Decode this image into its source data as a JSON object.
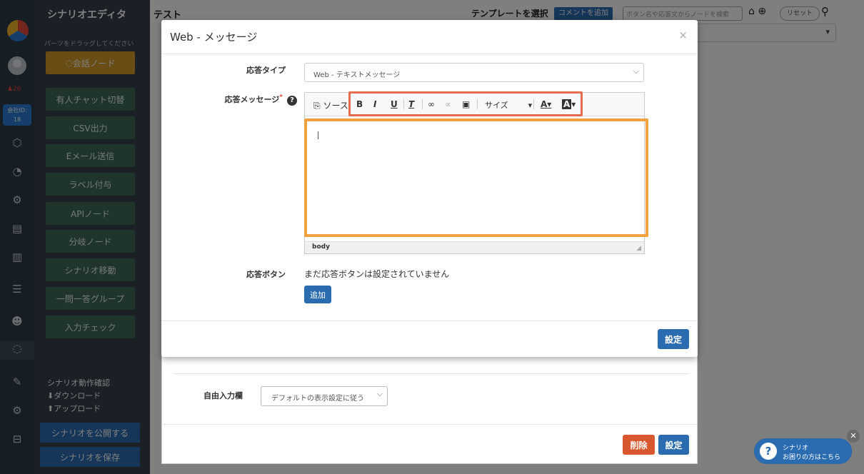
{
  "app": {
    "palette_title": "シナリオエディタ",
    "palette_hint": "パーツをドラッグしてください",
    "notification_count": "26",
    "company_id_label": "会社ID:",
    "company_id": "18",
    "palette_buttons": [
      "会話ノード",
      "有人チャット切替",
      "CSV出力",
      "Eメール送信",
      "ラベル付与",
      "APIノード",
      "分岐ノード",
      "シナリオ移動",
      "一問一答グループ",
      "入力チェック"
    ],
    "links": [
      "シナリオ動作確認",
      "ダウンロード",
      "アップロード"
    ],
    "publish_button": "シナリオを公開する",
    "save_button": "シナリオを保存"
  },
  "topbar": {
    "scenario_name": "テスト",
    "template_label": "テンプレートを選択",
    "comment_button": "コメントを追加",
    "search_placeholder": "ボタン名や応答文からノードを検索",
    "reset_button": "リセット"
  },
  "under_panel": {
    "free_input_label": "自由入力欄",
    "free_input_value": "デフォルトの表示設定に従う",
    "delete_button": "削除",
    "save_button": "設定"
  },
  "modal": {
    "title": "Web - メッセージ",
    "close": "×",
    "response_type_label": "応答タイプ",
    "response_type_value": "Web - テキストメッセージ",
    "response_message_label": "応答メッセージ",
    "required_mark": "*",
    "toolbar": {
      "source": "ソース",
      "bold": "B",
      "italic": "I",
      "underline": "U",
      "clear_format": "T",
      "size_label": "サイズ",
      "font_color": "A",
      "bg_color": "A"
    },
    "statusbar_path": "body",
    "response_buttons_label": "応答ボタン",
    "no_buttons_text": "まだ応答ボタンは設定されていません",
    "add_button": "追加",
    "save_button": "設定"
  },
  "help_widget": {
    "line1": "シナリオ",
    "line2": "お困りの方はこちら"
  }
}
